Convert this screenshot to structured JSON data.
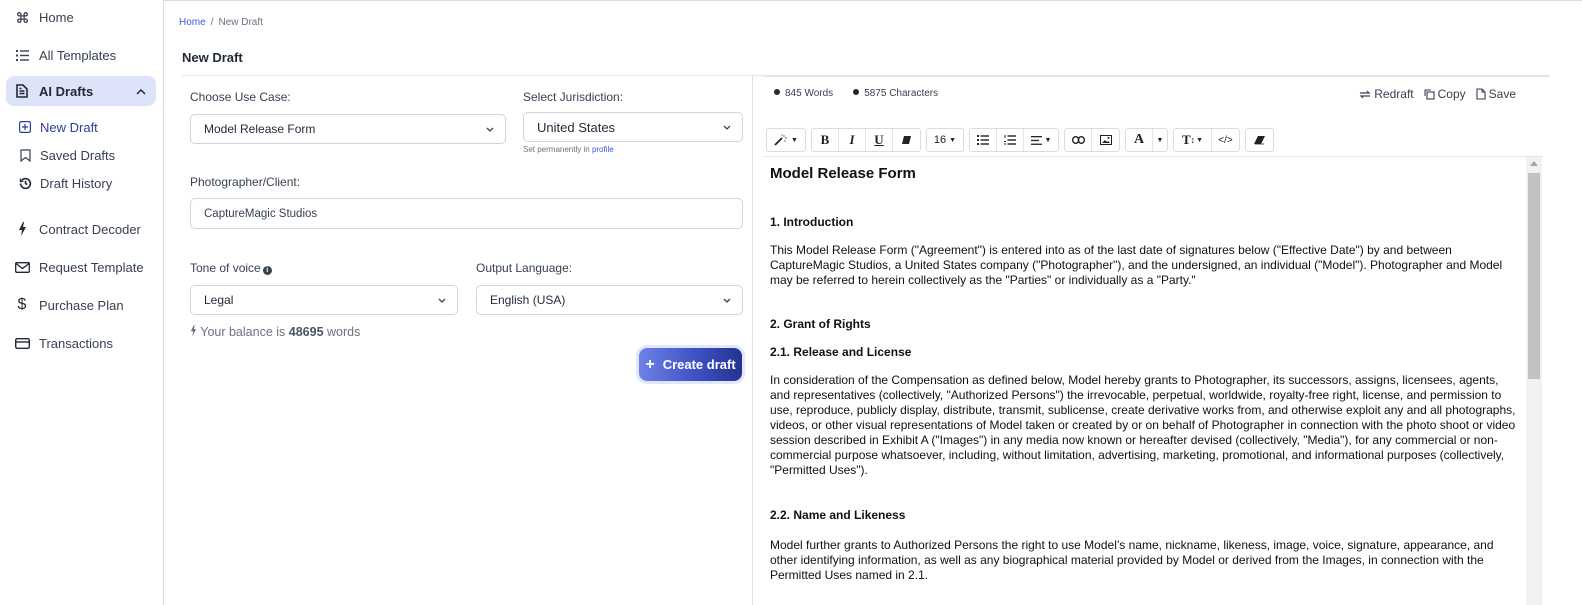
{
  "sidebar": {
    "items": [
      {
        "label": "Home",
        "icon": "command-icon"
      },
      {
        "label": "All Templates",
        "icon": "list-icon"
      },
      {
        "label": "AI Drafts",
        "icon": "document-icon",
        "expanded": true,
        "active": true
      },
      {
        "label": "Contract Decoder",
        "icon": "bolt-icon"
      },
      {
        "label": "Request Template",
        "icon": "mail-icon"
      },
      {
        "label": "Purchase Plan",
        "icon": "dollar-icon"
      },
      {
        "label": "Transactions",
        "icon": "card-icon"
      }
    ],
    "sub_items": [
      {
        "label": "New Draft",
        "icon": "plus-square-icon",
        "active": true
      },
      {
        "label": "Saved Drafts",
        "icon": "bookmark-icon"
      },
      {
        "label": "Draft History",
        "icon": "history-icon"
      }
    ]
  },
  "breadcrumb": {
    "home": "Home",
    "separator": "/",
    "current": "New Draft"
  },
  "page_title": "New Draft",
  "form": {
    "use_case": {
      "label": "Choose Use Case:",
      "value": "Model Release Form"
    },
    "jurisdiction": {
      "label": "Select Jurisdiction:",
      "value": "United States",
      "hint_prefix": "Set permanently in",
      "hint_link": "profile"
    },
    "client": {
      "label": "Photographer/Client:",
      "value": "CaptureMagic Studios"
    },
    "tone": {
      "label": "Tone of voice",
      "value": "Legal"
    },
    "language": {
      "label": "Output Language:",
      "value": "English (USA)"
    },
    "balance": {
      "prefix": "Your balance is",
      "amount": "48695",
      "suffix": "words"
    },
    "create_button": "Create draft"
  },
  "editor": {
    "stats": {
      "words": "845 Words",
      "characters": "5875 Characters"
    },
    "actions": {
      "redraft": "Redraft",
      "copy": "Copy",
      "save": "Save"
    },
    "toolbar": {
      "font_size": "16"
    },
    "document": {
      "title": "Model Release Form",
      "s1_heading": "1. Introduction",
      "s1_text": "This Model Release Form (\"Agreement\") is entered into as of the last date of signatures below (\"Effective Date\") by and between CaptureMagic Studios, a United States company (\"Photographer\"), and the undersigned, an individual (\"Model\"). Photographer and Model may be referred to herein collectively as the \"Parties\" or individually as a \"Party.\"",
      "s2_heading": "2. Grant of Rights",
      "s21_heading": "2.1. Release and License",
      "s21_text": "In consideration of the Compensation as defined below, Model hereby grants to Photographer, its successors, assigns, licensees, agents, and representatives (collectively, \"Authorized Persons\") the irrevocable, perpetual, worldwide, royalty-free right, license, and permission to use, reproduce, publicly display, distribute, transmit, sublicense, create derivative works from, and otherwise exploit any and all photographs, videos, or other visual representations of Model taken or created by or on behalf of Photographer in connection with the photo shoot or video session described in Exhibit A (\"Images\") in any media now known or hereafter devised (collectively, \"Media\"), for any commercial or non-commercial purpose whatsoever, including, without limitation, advertising, marketing, promotional, and informational purposes (collectively, \"Permitted Uses\").",
      "s22_heading": "2.2. Name and Likeness",
      "s22_text": "Model further grants to Authorized Persons the right to use Model’s name, nickname, likeness, image, voice, signature, appearance, and other identifying information, as well as any biographical material provided by Model or derived from the Images, in connection with the Permitted Uses named in 2.1."
    }
  },
  "colors": {
    "accent": "#3b5bdb",
    "active_bg": "#dde3f8",
    "button_start": "#6f82e8",
    "button_end": "#23338f"
  }
}
